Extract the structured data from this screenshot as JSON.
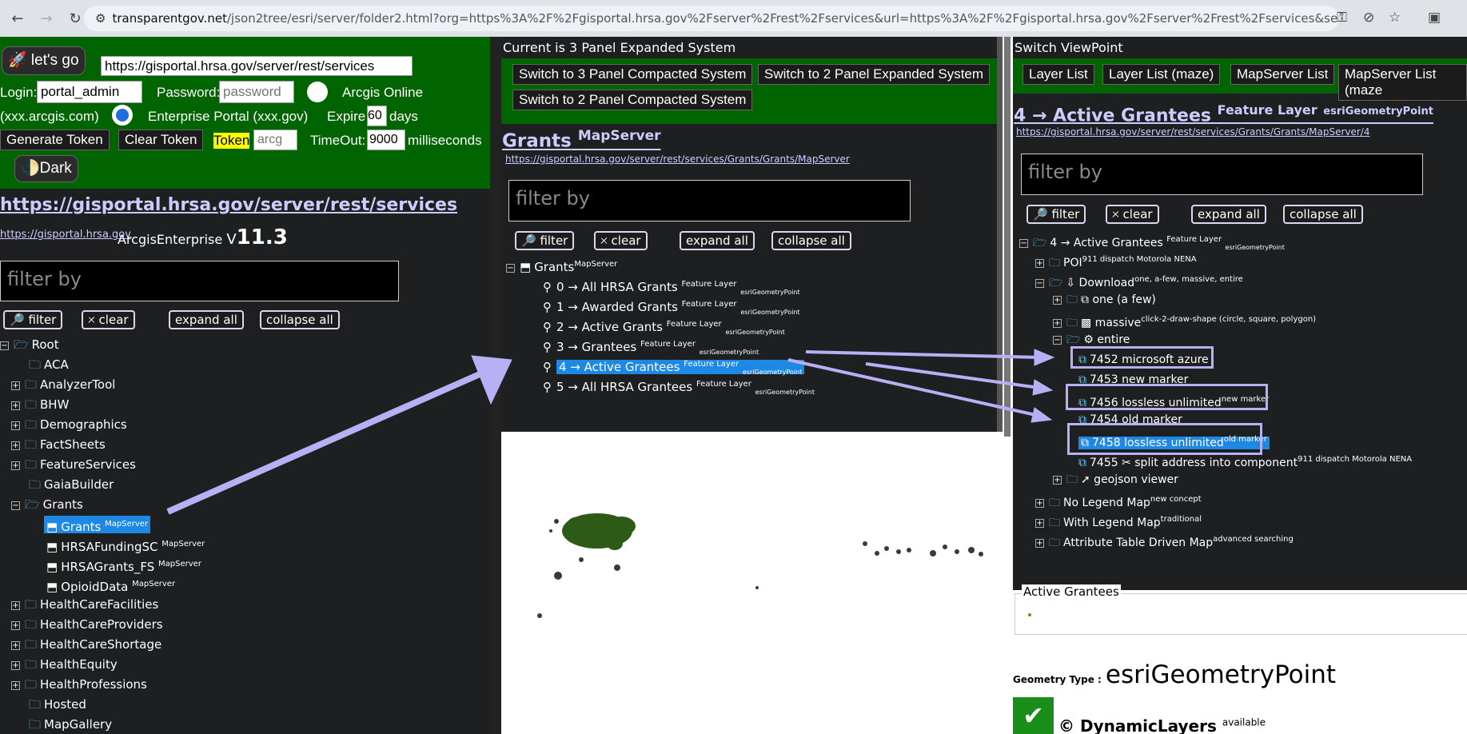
{
  "browser": {
    "url_host": "transparentgov.net",
    "url_rest": "/json2tree/esri/server/folder2.html?org=https%3A%2F%2Fgisportal.hrsa.gov%2Fserver%2Frest%2Fservices&url=https%3A%2F%2Fgisportal.hrsa.gov%2Fserver%2Frest%2Fservices&select_folder=85&select_layer=4&arcgis_onli..."
  },
  "left": {
    "go_label": "🚀 let's go",
    "url_value": "https://gisportal.hrsa.gov/server/rest/services",
    "login_label": "Login:",
    "login_value": "portal_admin",
    "password_label": "Password:",
    "password_placeholder": "password",
    "arcgis_online": "Arcgis Online",
    "online_hint": "(xxx.arcgis.com)",
    "enterprise": "Enterprise Portal (xxx.gov)",
    "expire_label": "Expire",
    "expire_value": "60",
    "days_label": "days",
    "generate_token": "Generate Token",
    "clear_token": "Clear Token",
    "token_label": "Token",
    "token_placeholder": "arcg",
    "timeout_label": "TimeOut:",
    "timeout_value": "9000",
    "ms_label": "milliseconds",
    "dark_label": "🌓Dark",
    "services_title": "https://gisportal.hrsa.gov/server/rest/services",
    "portal_link": "https://gisportal.hrsa.gov",
    "enterprise_label": "ArcgisEnterprise",
    "version_v": "V",
    "version": "11.3",
    "filter_placeholder": "filter by",
    "filter_btn": "🔎 filter",
    "clear_btn": "🞩 clear",
    "expand_btn": "expand all",
    "collapse_btn": "collapse all",
    "tree": {
      "root": "Root",
      "items": [
        "ACA",
        "AnalyzerTool",
        "BHW",
        "Demographics",
        "FactSheets",
        "FeatureServices",
        "GaiaBuilder",
        "Grants"
      ],
      "grants_children": [
        {
          "name": "Grants",
          "type": "MapServer"
        },
        {
          "name": "HRSAFundingSC",
          "type": "MapServer"
        },
        {
          "name": "HRSAGrants_FS",
          "type": "MapServer"
        },
        {
          "name": "OpioidData",
          "type": "MapServer"
        }
      ],
      "more": [
        "HealthCareFacilities",
        "HealthCareProviders",
        "HealthCareShortage",
        "HealthEquity",
        "HealthProfessions",
        "Hosted",
        "MapGallery"
      ]
    }
  },
  "middle": {
    "header": "Current is 3 Panel Expanded System",
    "btn_3c": "Switch to 3 Panel Compacted System",
    "btn_2e": "Switch to 2 Panel Expanded System",
    "btn_2c": "Switch to 2 Panel Compacted System",
    "title": "Grants",
    "title_sup": "MapServer",
    "link": "https://gisportal.hrsa.gov/server/rest/services/Grants/Grants/MapServer",
    "filter_placeholder": "filter by",
    "filter_btn": "🔎 filter",
    "clear_btn": "🞩 clear",
    "expand_btn": "expand all",
    "collapse_btn": "collapse all",
    "root": "Grants",
    "root_sup": "MapServer",
    "layers": [
      {
        "label": "0 → All HRSA Grants",
        "sup": "Feature Layer",
        "sub": "esriGeometryPoint"
      },
      {
        "label": "1 → Awarded Grants",
        "sup": "Feature Layer",
        "sub": "esriGeometryPoint"
      },
      {
        "label": "2 → Active Grants",
        "sup": "Feature Layer",
        "sub": "esriGeometryPoint"
      },
      {
        "label": "3 → Grantees",
        "sup": "Feature Layer",
        "sub": "esriGeometryPoint"
      },
      {
        "label": "4 → Active Grantees",
        "sup": "Feature Layer",
        "sub": "esriGeometryPoint"
      },
      {
        "label": "5 → All HRSA Grantees",
        "sup": "Feature Layer",
        "sub": "esriGeometryPoint"
      }
    ]
  },
  "right": {
    "header": "Switch ViewPoint",
    "btn_layer_list": "Layer List",
    "btn_layer_maze": "Layer List (maze)",
    "btn_mapserver_list": "MapServer List",
    "btn_mapserver_maze": "MapServer List (maze",
    "title": "4 → Active Grantees",
    "title_sup": "Feature Layer",
    "title_sup2": "esriGeometryPoint",
    "link": "https://gisportal.hrsa.gov/server/rest/services/Grants/Grants/MapServer/4",
    "filter_placeholder": "filter by",
    "filter_btn": "🔎 filter",
    "clear_btn": "🞩 clear",
    "expand_btn": "expand all",
    "collapse_btn": "collapse all",
    "tree": {
      "root": "4 → Active Grantees",
      "root_sup": "Feature Layer",
      "root_sub": "esriGeometryPoint",
      "poi": "POI",
      "poi_sup": "911 dispatch Motorola NENA",
      "download": "⇩ Download",
      "download_sup": "one, a-few, massive, entire",
      "one": "⧉ one (a few)",
      "massive": "▩ massive",
      "massive_sup": "click-2-draw-shape (circle, square, polygon)",
      "entire": "⚙ entire",
      "i7452": "7452 microsoft azure",
      "i7453": "7453 new marker",
      "i7456": "7456 lossless unlimited",
      "i7456_sup": "new marker",
      "i7454": "7454 old marker",
      "i7458": "7458 lossless unlimited",
      "i7458_sup": "old marker",
      "i7455": "7455 ✂ split address into component",
      "i7455_sup": "911 dispatch Motorola NENA",
      "geojson": "➚ geojson viewer",
      "nolegend": "No Legend Map",
      "nolegend_sup": "new concept",
      "withlegend": "With Legend Map",
      "withlegend_sup": "traditional",
      "attr": "Attribute Table Driven Map",
      "attr_sup": "advanced searching"
    },
    "legend_title": "Active Grantees",
    "geometry_label": "Geometry Type :",
    "geometry_value": "esriGeometryPoint",
    "dynamic_label": "© DynamicLayers",
    "dynamic_sup": "available"
  },
  "colors": {
    "green": "#006400",
    "accent": "#b7b0f5",
    "selected": "#1e88e5"
  }
}
